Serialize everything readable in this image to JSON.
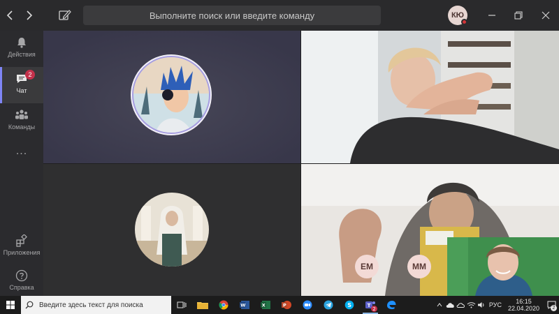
{
  "titlebar": {
    "search_placeholder": "Выполните поиск или введите команду",
    "user_initials": "КЮ"
  },
  "rail": {
    "items": [
      {
        "label": "Действия",
        "icon": "bell-icon"
      },
      {
        "label": "Чат",
        "icon": "chat-icon",
        "badge": "2",
        "active": true
      },
      {
        "label": "Команды",
        "icon": "teams-icon"
      },
      {
        "label": "...",
        "icon": "more-icon"
      },
      {
        "label": "Приложения",
        "icon": "apps-icon"
      },
      {
        "label": "Справка",
        "icon": "help-icon"
      }
    ]
  },
  "call": {
    "participants": [
      {
        "initials": "ЕМ"
      },
      {
        "initials": "ММ"
      }
    ]
  },
  "taskbar": {
    "search_placeholder": "Введите здесь текст для поиска",
    "language": "РУС",
    "time": "16:15",
    "date": "22.04.2020",
    "notifications": "2",
    "teams_badge": "2"
  },
  "colors": {
    "accent": "#7f85f5",
    "badge": "#c4314b",
    "titlebar": "#2a2a2c",
    "rail": "#2b2b2e"
  }
}
